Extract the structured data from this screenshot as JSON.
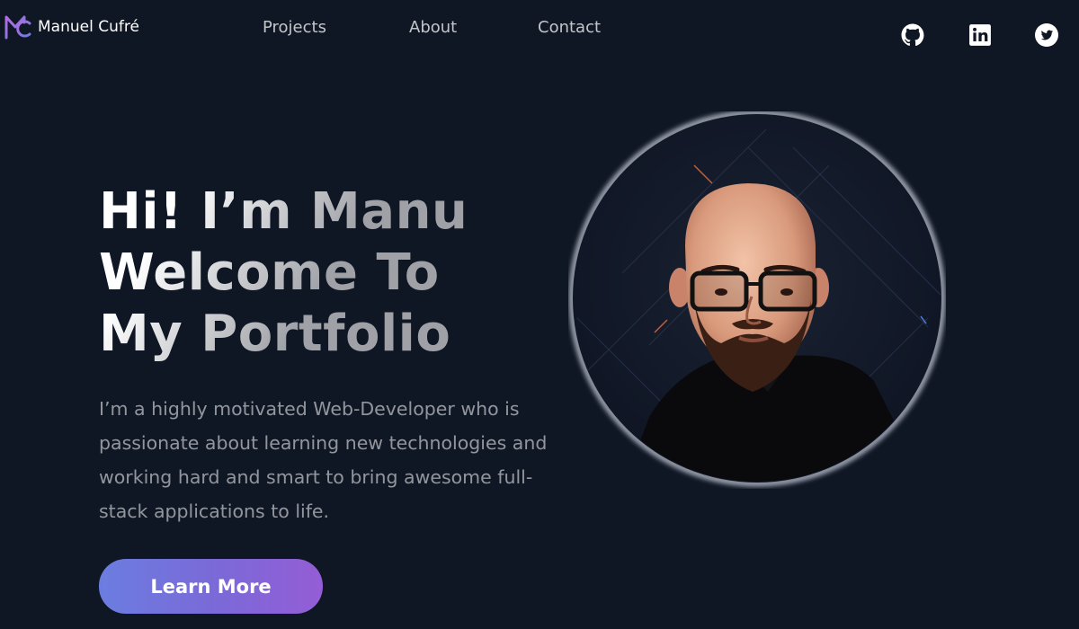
{
  "header": {
    "brand_name": "Manuel Cufré",
    "nav": [
      {
        "label": "Projects"
      },
      {
        "label": "About"
      },
      {
        "label": "Contact"
      }
    ],
    "social_icons": [
      "github-icon",
      "linkedin-icon",
      "twitter-icon"
    ]
  },
  "hero": {
    "title_lines": [
      "Hi! I’m Manu",
      "Welcome To",
      "My Portfolio"
    ],
    "description": "I’m a highly motivated Web-Developer who is passionate about learning new technologies and working hard and smart to bring awesome full-stack applications to life.",
    "button_label": "Learn More"
  },
  "colors": {
    "background": "#0f1624",
    "accent_start": "#6b7de0",
    "accent_end": "#945dd6",
    "logo": "#945dd6"
  }
}
